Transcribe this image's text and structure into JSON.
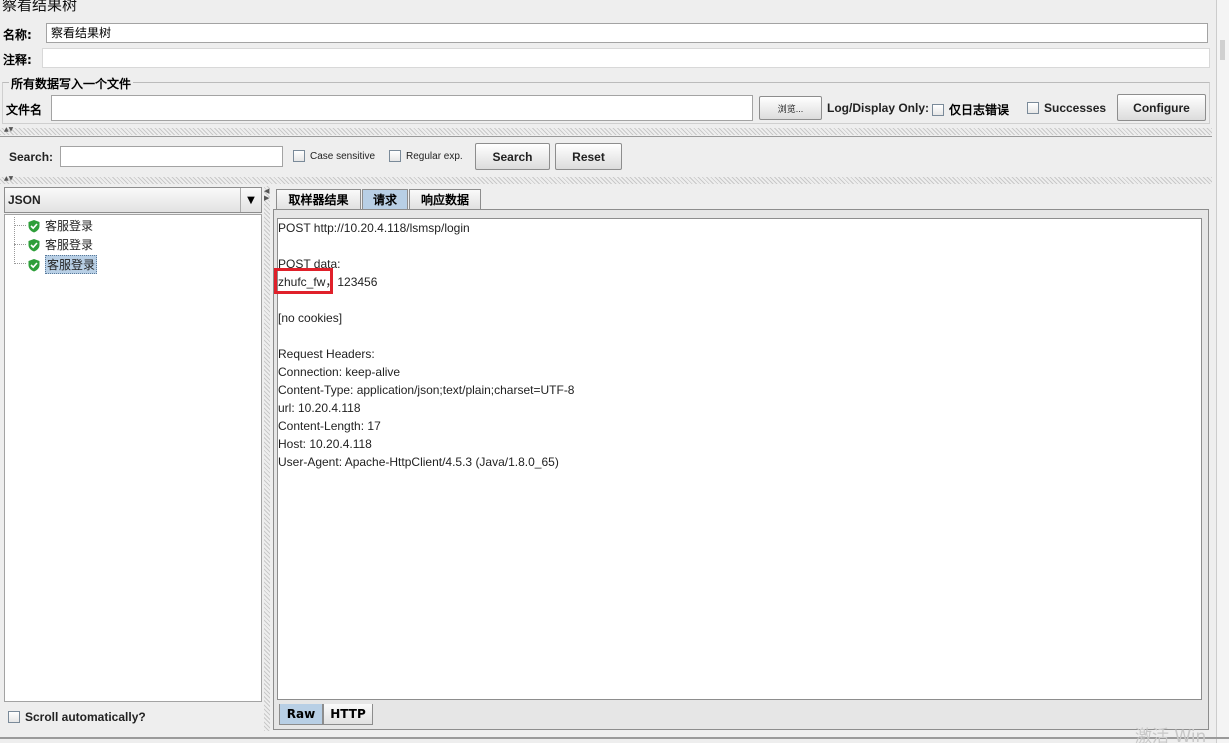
{
  "window": {
    "title": "察看结果树"
  },
  "form": {
    "name_label": "名称:",
    "name_value": "察看结果树",
    "comment_label": "注释:",
    "comment_value": ""
  },
  "file_section": {
    "legend": "所有数据写入一个文件",
    "filename_label": "文件名",
    "filename_value": "",
    "browse_label": "浏览...",
    "log_display_label": "Log/Display Only:",
    "errors_label": "仅日志错误",
    "successes_label": "Successes",
    "configure_label": "Configure"
  },
  "search_bar": {
    "search_label": "Search:",
    "search_value": "",
    "case_sensitive_label": "Case sensitive",
    "regex_label": "Regular exp.",
    "search_button": "Search",
    "reset_button": "Reset"
  },
  "left_panel": {
    "renderer_selected": "JSON",
    "tree_items": [
      "客服登录",
      "客服登录",
      "客服登录"
    ],
    "selected_index": 2,
    "scroll_auto_label": "Scroll automatically?"
  },
  "right_panel": {
    "tabs": [
      "取样器结果",
      "请求",
      "响应数据"
    ],
    "active_tab": 1,
    "bottom_tabs": [
      "Raw",
      "HTTP"
    ],
    "active_bottom_tab": 0,
    "request_lines": [
      "POST http://10.20.4.118/lsmsp/login",
      "",
      "POST data:",
      "zhufc_fw，123456",
      "",
      "[no cookies]",
      "",
      "Request Headers:",
      "Connection: keep-alive",
      "Content-Type: application/json;text/plain;charset=UTF-8",
      "url: 10.20.4.118",
      "Content-Length: 17",
      "Host: 10.20.4.118",
      "User-Agent: Apache-HttpClient/4.5.3 (Java/1.8.0_65)"
    ]
  },
  "watermark": {
    "text": "激活 Win"
  },
  "colors": {
    "highlight_box": "#e0202a",
    "selection": "#b8cfe5",
    "shield": "#2e9e3a"
  }
}
